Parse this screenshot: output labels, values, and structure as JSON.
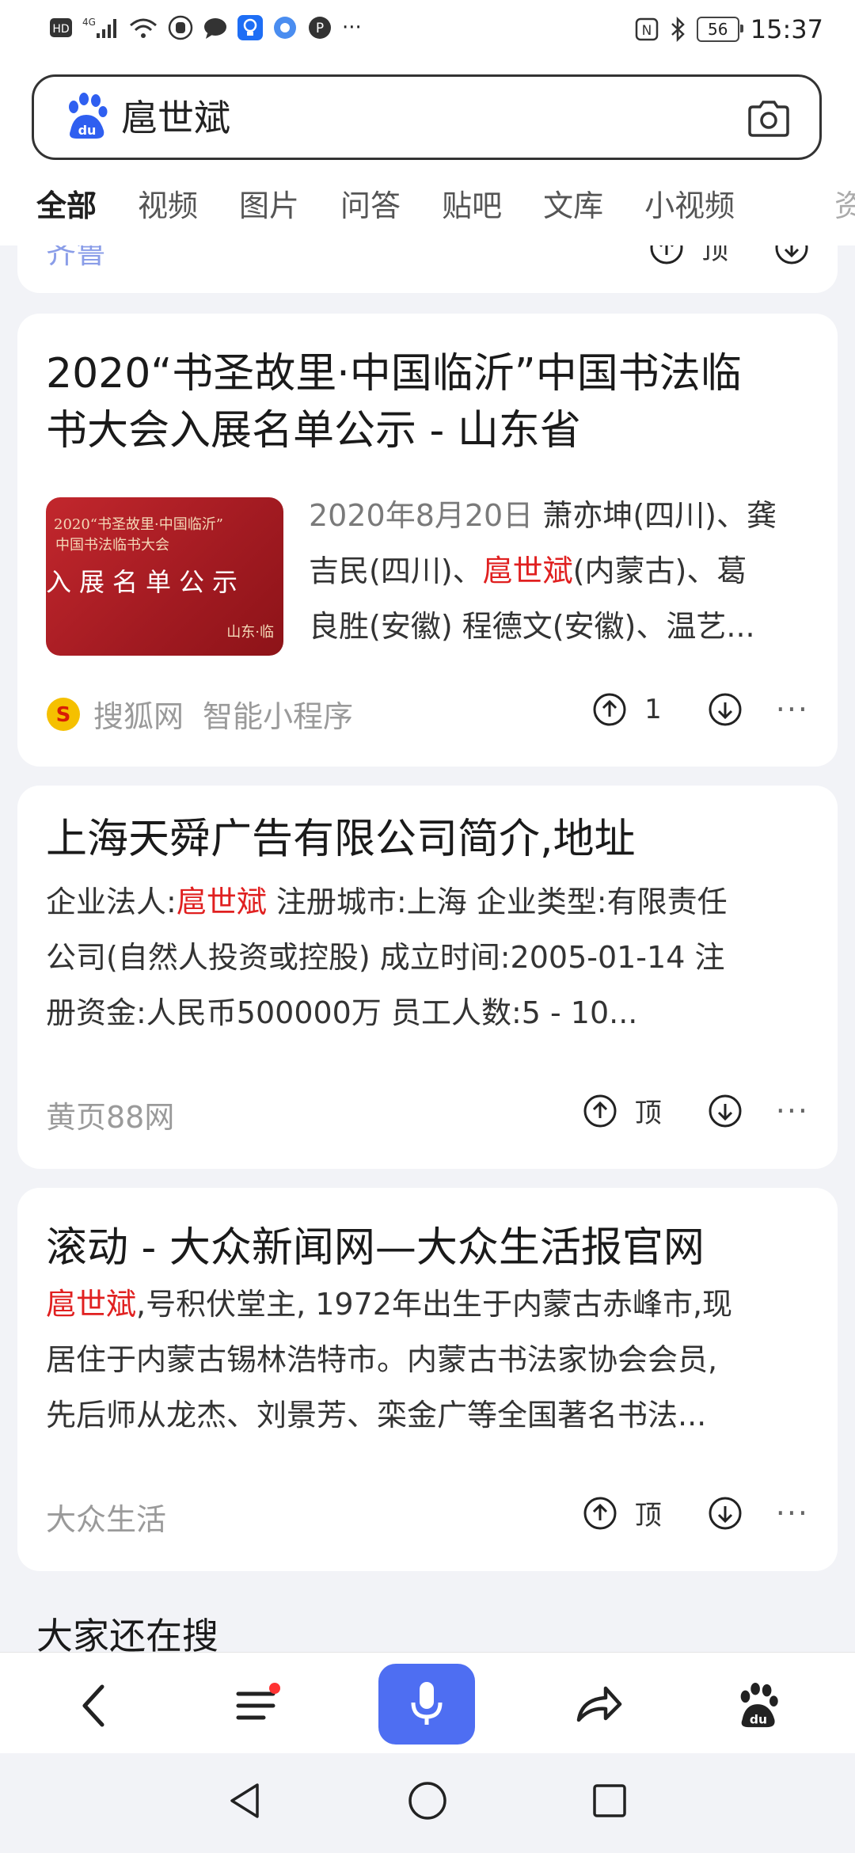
{
  "status_bar": {
    "network": "4G",
    "battery": "56",
    "time": "15:37"
  },
  "search": {
    "query": "扈世斌"
  },
  "tabs": [
    {
      "label": "全部",
      "active": true
    },
    {
      "label": "视频"
    },
    {
      "label": "图片"
    },
    {
      "label": "问答"
    },
    {
      "label": "贴吧"
    },
    {
      "label": "文库"
    },
    {
      "label": "小视频"
    }
  ],
  "tab_overflow": "资",
  "results": [
    {
      "title_line1": "2020“书圣故里·中国临沂”中国书法临",
      "title_line2": "书大会入展名单公示 - 山东省",
      "thumb": {
        "line1": "2020“书圣故里·中国临沂”",
        "line2": "中国书法临书大会",
        "line3": "入展名单公示",
        "line4": "山东·临"
      },
      "snippet": {
        "date": "2020年8月20日",
        "l1_rest": " 萧亦坤(四川)、龚",
        "l2_pre": "吉民(四川)、",
        "l2_hl": "扈世斌",
        "l2_post": "(内蒙古)、葛",
        "l3": "良胜(安徽) 程德文(安徽)、温艺..."
      },
      "source": "搜狐网",
      "source_extra": "智能小程序",
      "upvotes": "1"
    },
    {
      "title": "上海天舜广告有限公司简介,地址",
      "snippet": {
        "l1_pre": "企业法人:",
        "l1_hl": "扈世斌",
        "l1_post": " 注册城市:上海 企业类型:有限责任",
        "l2": "公司(自然人投资或控股) 成立时间:2005-01-14 注",
        "l3": "册资金:人民币500000万 员工人数:5 - 10..."
      },
      "source": "黄页88网",
      "upvote_label": "顶"
    },
    {
      "title": "滚动 - 大众新闻网—大众生活报官网",
      "snippet": {
        "l1_hl": "扈世斌",
        "l1_post": ",号积伏堂主, 1972年出生于内蒙古赤峰市,现",
        "l2": "居住于内蒙古锡林浩特市。内蒙古书法家协会会员,",
        "l3": "先后师从龙杰、刘景芳、栾金广等全国著名书法..."
      },
      "source": "大众生活",
      "upvote_label": "顶"
    }
  ],
  "prev_card": {
    "cut_text": "齐鲁",
    "upvote_label": "顶"
  },
  "related_title": "大家还在搜",
  "colors": {
    "accent": "#4e6ef2",
    "highlight": "#e02020"
  }
}
